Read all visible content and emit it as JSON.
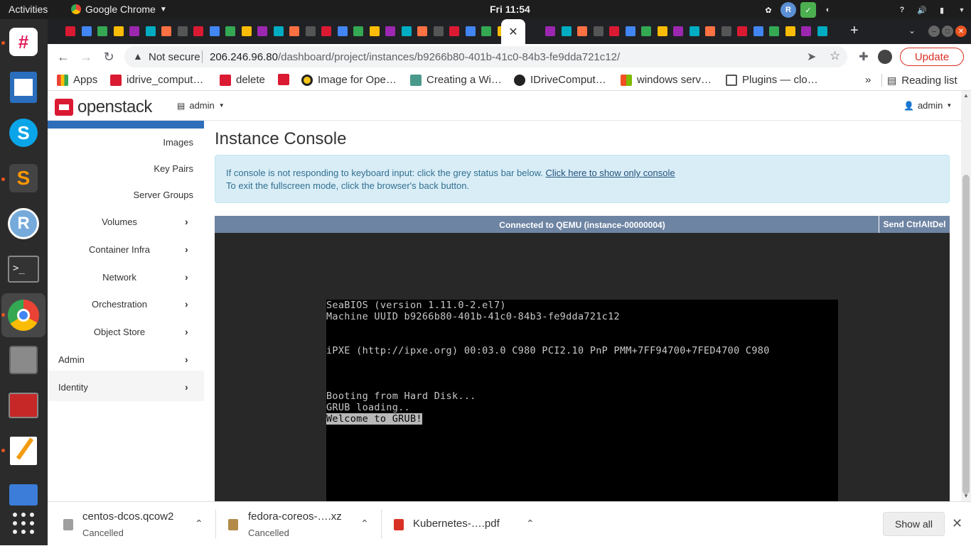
{
  "system": {
    "activities": "Activities",
    "app_name": "Google Chrome",
    "clock": "Fri 11:54"
  },
  "browser": {
    "address": {
      "security_label": "Not secure",
      "url_host": "206.246.96.80",
      "url_path": "/dashboard/project/instances/b9266b80-401b-41c0-84b3-fe9dda721c12/"
    },
    "update_label": "Update",
    "bookmarks": [
      {
        "label": "Apps",
        "color": "#4285f4"
      },
      {
        "label": "idrive_comput…",
        "color": "#da1a32"
      },
      {
        "label": "delete",
        "color": "#da1a32"
      },
      {
        "label": "",
        "color": "#da1a32"
      },
      {
        "label": "Image for Ope…",
        "color": "#222222"
      },
      {
        "label": "Creating a Wi…",
        "color": "#4a9a8c"
      },
      {
        "label": "IDriveComput…",
        "color": "#222222"
      },
      {
        "label": "windows serv…",
        "color": "#f25022"
      },
      {
        "label": "Plugins — clo…",
        "color": "#555555"
      }
    ],
    "reading_list": "Reading list",
    "overflow": "»"
  },
  "openstack": {
    "brand": "openstack",
    "project_menu": "admin",
    "user_menu": "admin",
    "sidebar": {
      "sub_items": [
        "Images",
        "Key Pairs",
        "Server Groups"
      ],
      "main_items": [
        "Volumes",
        "Container Infra",
        "Network",
        "Orchestration",
        "Object Store"
      ],
      "root_items": [
        "Admin",
        "Identity"
      ]
    },
    "page_title": "Instance Console",
    "alert": {
      "line1": "If console is not responding to keyboard input: click the grey status bar below.",
      "link": "Click here to show only console",
      "line2": "To exit the fullscreen mode, click the browser's back button."
    },
    "console": {
      "status": "Connected to QEMU (instance-00000004)",
      "send_cad": "Send CtrlAltDel",
      "lines": [
        "SeaBIOS (version 1.11.0-2.el7)",
        "Machine UUID b9266b80-401b-41c0-84b3-fe9dda721c12",
        "iPXE (http://ipxe.org) 00:03.0 C980 PCI2.10 PnP PMM+7FF94700+7FED4700 C980",
        "Booting from Hard Disk...",
        "GRUB loading..",
        "Welcome to GRUB!"
      ]
    }
  },
  "downloads": {
    "items": [
      {
        "name": "centos-dcos.qcow2",
        "status": "Cancelled",
        "icon_color": "#9e9e9e"
      },
      {
        "name": "fedora-coreos-….xz",
        "status": "Cancelled",
        "icon_color": "#b38a4a"
      },
      {
        "name": "Kubernetes-….pdf",
        "status": "",
        "icon_color": "#d93025"
      }
    ],
    "show_all": "Show all"
  }
}
